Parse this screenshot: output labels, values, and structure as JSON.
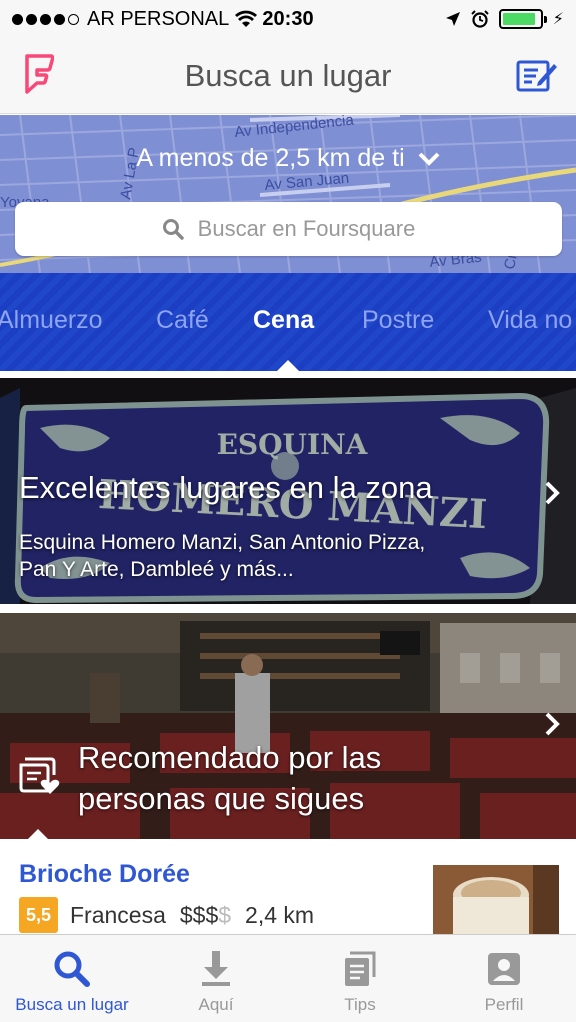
{
  "status_bar": {
    "carrier": "AR PERSONAL",
    "time": "20:30",
    "battery_level": 0.9,
    "icons": [
      "signal-icon",
      "wifi-icon",
      "location-arrow-icon",
      "alarm-icon",
      "battery-icon",
      "charging-bolt-icon"
    ]
  },
  "nav": {
    "title": "Busca un lugar",
    "left_icon": "foursquare-logo",
    "right_icon": "compose-icon"
  },
  "map": {
    "distance_label": "A menos de 2,5 km de ti",
    "street_labels": [
      "Av Independencia",
      "Av San Juan",
      "Av Bras",
      "Cr",
      "Av La P",
      "Yovana"
    ],
    "search_placeholder": "Buscar en Foursquare"
  },
  "categories": {
    "items": [
      "Almuerzo",
      "Café",
      "Cena",
      "Postre",
      "Vida no"
    ],
    "selected": "Cena"
  },
  "cards": [
    {
      "title": "Excelentes lugares en la zona",
      "subtitle_line1": "Esquina Homero Manzi, San Antonio Pizza,",
      "subtitle_line2": "Pan Y Arte, Dambleé y más...",
      "sign_text_top": "ESQUINA",
      "sign_text_bottom": "HOMERO MANZI"
    },
    {
      "title_line1": "Recomendado por las",
      "title_line2": "personas que sigues"
    }
  ],
  "venue": {
    "name": "Brioche Dorée",
    "rating": "5,5",
    "category": "Francesa",
    "price_filled": "$$$",
    "price_empty": "$",
    "distance": "2,4 km"
  },
  "tabbar": {
    "items": [
      {
        "label": "Busca un lugar",
        "icon": "search-icon"
      },
      {
        "label": "Aquí",
        "icon": "download-arrow-icon"
      },
      {
        "label": "Tips",
        "icon": "tips-icon"
      },
      {
        "label": "Perfil",
        "icon": "profile-icon"
      }
    ]
  },
  "colors": {
    "accent_blue": "#2f57d4",
    "logo_pink": "#f94877",
    "rating_orange": "#f5a623",
    "tabs_bg": "#1b3ec2",
    "map_bg": "#7f8fd4"
  }
}
